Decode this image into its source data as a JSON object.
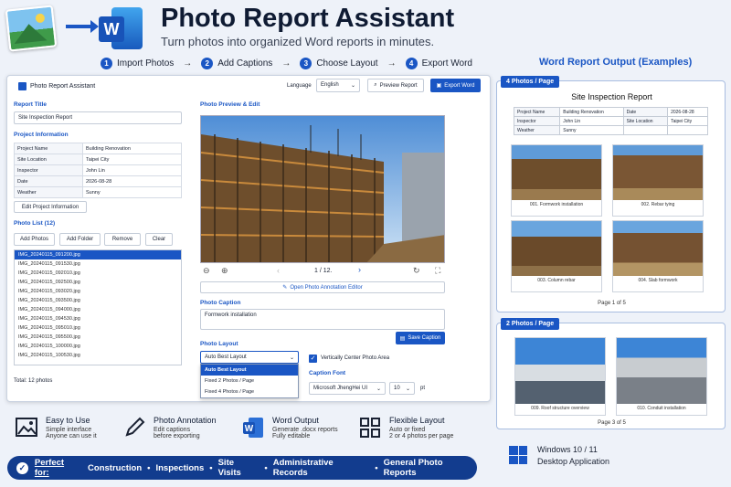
{
  "header": {
    "title": "Photo Report Assistant",
    "subtitle": "Turn photos into organized Word reports in minutes."
  },
  "steps": [
    {
      "num": "1",
      "label": "Import Photos"
    },
    {
      "num": "2",
      "label": "Add Captions"
    },
    {
      "num": "3",
      "label": "Choose Layout"
    },
    {
      "num": "4",
      "label": "Export Word"
    }
  ],
  "step_arrow": "→",
  "output_title": "Word Report Output (Examples)",
  "app": {
    "window_title": "Photo Report Assistant",
    "language_label": "Language",
    "language_value": "English",
    "preview_btn": "Preview Report",
    "export_btn": "Export Word",
    "report_title_label": "Report Title",
    "report_title_value": "Site Inspection Report",
    "project_info_label": "Project Information",
    "project_info": [
      {
        "k": "Project Name",
        "v": "Building Renovation"
      },
      {
        "k": "Site Location",
        "v": "Taipei City"
      },
      {
        "k": "Inspector",
        "v": "John Lin"
      },
      {
        "k": "Date",
        "v": "2026-08-28"
      },
      {
        "k": "Weather",
        "v": "Sunny"
      }
    ],
    "edit_project_btn": "Edit Project Information",
    "photo_list_label": "Photo List (12)",
    "add_photos_btn": "Add Photos",
    "add_folder_btn": "Add Folder",
    "remove_btn": "Remove",
    "clear_btn": "Clear",
    "files": [
      "IMG_20240115_091200.jpg",
      "IMG_20240115_091530.jpg",
      "IMG_20240115_092010.jpg",
      "IMG_20240115_092500.jpg",
      "IMG_20240115_093020.jpg",
      "IMG_20240115_093500.jpg",
      "IMG_20240115_094000.jpg",
      "IMG_20240115_094530.jpg",
      "IMG_20240115_095010.jpg",
      "IMG_20240115_095500.jpg",
      "IMG_20240115_100000.jpg",
      "IMG_20240115_100530.jpg"
    ],
    "total": "Total: 12 photos",
    "preview_label": "Photo Preview & Edit",
    "page_counter": "1 / 12.",
    "annotation_btn": "Open Photo Annotation Editor",
    "caption_label": "Photo Caption",
    "caption_value": "Formwork installation",
    "save_caption_btn": "Save Caption",
    "layout_label": "Photo Layout",
    "layout_value": "Auto Best Layout",
    "layout_options": [
      "Auto Best Layout",
      "Fixed 2 Photos / Page",
      "Fixed 4 Photos / Page"
    ],
    "center_checkbox": "Vertically Center Photo Area",
    "caption_font_label": "Caption Font",
    "font_value": "Microsoft JhengHei UI",
    "size_value": "10",
    "size_unit": "pt"
  },
  "report4": {
    "tag": "4 Photos / Page",
    "title": "Site Inspection Report",
    "table": [
      [
        "Project Name",
        "Building Renovation",
        "Date",
        "2026-08-28"
      ],
      [
        "Inspector",
        "John Lin",
        "Site Location",
        "Taipei City"
      ],
      [
        "Weather",
        "Sunny",
        "",
        ""
      ]
    ],
    "captions": [
      "001. Formwork installation",
      "002. Rebar tying",
      "003. Column rebar",
      "004. Slab formwork"
    ],
    "page": "Page 1 of 5"
  },
  "report2": {
    "tag": "2 Photos / Page",
    "captions": [
      "009. Roof structure overview",
      "010. Conduit installation"
    ],
    "page": "Page 3 of 5"
  },
  "features": [
    {
      "icon": "image-icon",
      "title": "Easy to Use",
      "l1": "Simple interface",
      "l2": "Anyone can use it"
    },
    {
      "icon": "pencil-icon",
      "title": "Photo Annotation",
      "l1": "Edit captions",
      "l2": "before exporting"
    },
    {
      "icon": "word-icon",
      "title": "Word Output",
      "l1": "Generate .docx reports",
      "l2": "Fully editable"
    },
    {
      "icon": "grid-icon",
      "title": "Flexible Layout",
      "l1": "Auto or fixed",
      "l2": "2 or 4 photos per page"
    }
  ],
  "perfect": {
    "label": "Perfect for:",
    "items": [
      "Construction",
      "Inspections",
      "Site Visits",
      "Administrative Records",
      "General Photo Reports"
    ],
    "sep": "•"
  },
  "platform": {
    "l1": "Windows 10 / 11",
    "l2": "Desktop Application"
  }
}
